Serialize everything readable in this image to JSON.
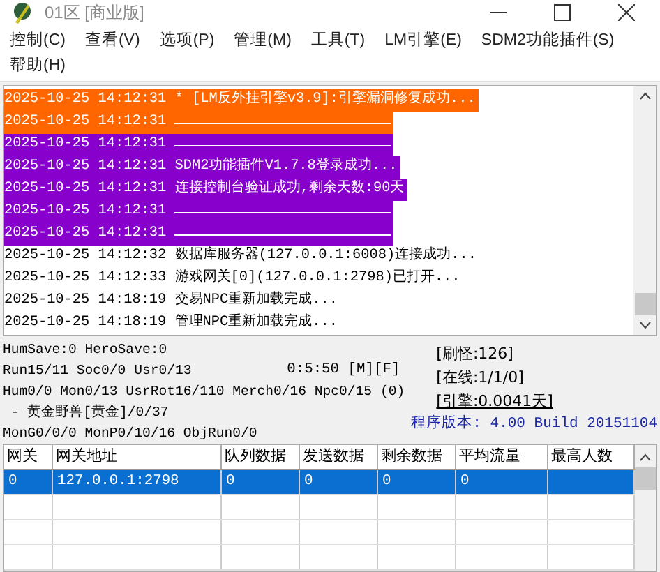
{
  "window": {
    "title": "01区 [商业版]"
  },
  "menu": [
    "控制(C)",
    "查看(V)",
    "选项(P)",
    "管理(M)",
    "工具(T)",
    "LM引擎(E)",
    "SDM2功能插件(S)",
    "帮助(H)"
  ],
  "log": [
    {
      "kind": "text",
      "time": "2025-10-25 14:12:31",
      "message": "* [LM反外挂引擎v3.9]:引擎漏洞修复成功...",
      "color": "#ff6600"
    },
    {
      "kind": "rule",
      "time": "2025-10-25 14:12:31",
      "color": "#ff6600"
    },
    {
      "kind": "rule",
      "time": "2025-10-25 14:12:31",
      "color": "#8800cc"
    },
    {
      "kind": "text",
      "time": "2025-10-25 14:12:31",
      "message": "SDM2功能插件V1.7.8登录成功...",
      "color": "#8800cc"
    },
    {
      "kind": "text",
      "time": "2025-10-25 14:12:31",
      "message": "连接控制台验证成功,剩余天数:90天",
      "color": "#8800cc"
    },
    {
      "kind": "rule",
      "time": "2025-10-25 14:12:31",
      "color": "#8800cc"
    },
    {
      "kind": "rule",
      "time": "2025-10-25 14:12:31",
      "color": "#8800cc"
    },
    {
      "kind": "text",
      "time": "2025-10-25 14:12:32",
      "message": "数据库服务器(127.0.0.1:6008)连接成功..."
    },
    {
      "kind": "text",
      "time": "2025-10-25 14:12:33",
      "message": "游戏网关[0](127.0.0.1:2798)已打开..."
    },
    {
      "kind": "text",
      "time": "2025-10-25 14:18:19",
      "message": "交易NPC重新加载完成..."
    },
    {
      "kind": "text",
      "time": "2025-10-25 14:18:19",
      "message": "管理NPC重新加载完成..."
    }
  ],
  "status": {
    "lines": [
      "HumSave:0 HeroSave:0",
      "Run15/11 Soc0/0 Usr0/13",
      "Hum0/0 Mon0/13 UsrRot16/110 Merch0/16 Npc0/15 (0)",
      " - 黄金野兽[黄金]/0/37",
      "MonG0/0/0 MonP0/10/16 ObjRun0/0"
    ],
    "timer": "0:5:50 [M][F]",
    "monsters": "[刷怪:126]",
    "online": "[在线:1/1/0]",
    "engine": "[引擎:0.0041天]",
    "version": "程序版本: 4.00 Build 20151104"
  },
  "table": {
    "columns": [
      "网关",
      "网关地址",
      "队列数据",
      "发送数据",
      "剩余数据",
      "平均流量",
      "最高人数"
    ],
    "rows": [
      {
        "selected": true,
        "cells": [
          "0",
          "127.0.0.1:2798",
          "0",
          "0",
          "0",
          "0",
          ""
        ]
      }
    ]
  }
}
